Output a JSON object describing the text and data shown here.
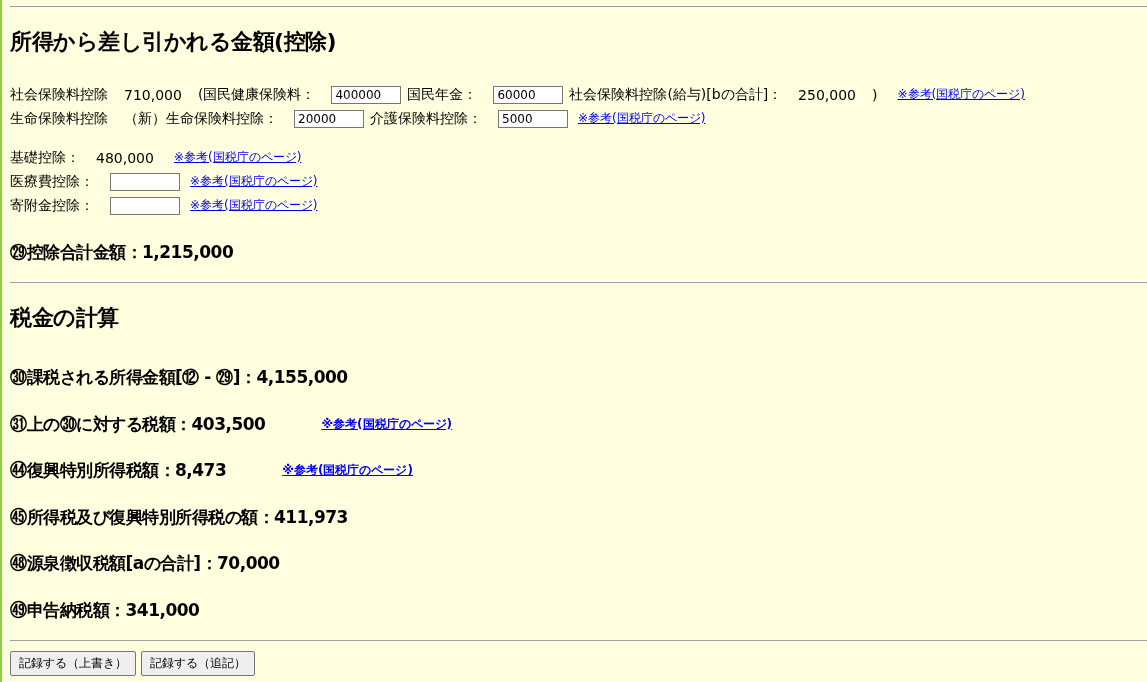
{
  "sections": [
    {
      "heading": "所得から差し引かれる金額(控除)",
      "groups": [
        {
          "kind": "rows",
          "lines": [
            {
              "parts": [
                {
                  "kind": "text",
                  "text": "社会保険料控除"
                },
                {
                  "kind": "text",
                  "text": "710,000"
                },
                {
                  "kind": "text",
                  "text": "(国民健康保険料："
                },
                {
                  "kind": "field",
                  "value": "400000"
                },
                {
                  "kind": "text",
                  "text": "国民年金："
                },
                {
                  "kind": "field",
                  "value": "60000"
                },
                {
                  "kind": "text",
                  "text": "社会保険料控除(給与)[bの合計]："
                },
                {
                  "kind": "text",
                  "text": "250,000"
                },
                {
                  "kind": "text",
                  "text": ")"
                },
                {
                  "kind": "link",
                  "text": "※参考(国税庁のページ)"
                }
              ]
            },
            {
              "parts": [
                {
                  "kind": "text",
                  "text": "生命保険料控除"
                },
                {
                  "kind": "text",
                  "text": "（新）生命保険料控除："
                },
                {
                  "kind": "field",
                  "value": "20000"
                },
                {
                  "kind": "text",
                  "text": "介護保険料控除："
                },
                {
                  "kind": "field",
                  "value": "5000"
                },
                {
                  "kind": "link",
                  "text": "※参考(国税庁のページ)"
                }
              ]
            }
          ]
        },
        {
          "kind": "rows",
          "lines": [
            {
              "parts": [
                {
                  "kind": "text",
                  "text": "基礎控除："
                },
                {
                  "kind": "text",
                  "text": "480,000"
                },
                {
                  "kind": "link",
                  "text": "※参考(国税庁のページ)"
                }
              ]
            },
            {
              "parts": [
                {
                  "kind": "text",
                  "text": "医療費控除："
                },
                {
                  "kind": "field"
                },
                {
                  "kind": "link",
                  "text": "※参考(国税庁のページ)"
                }
              ]
            },
            {
              "parts": [
                {
                  "kind": "text",
                  "text": "寄附金控除："
                },
                {
                  "kind": "field"
                },
                {
                  "kind": "link",
                  "text": "※参考(国税庁のページ)"
                }
              ]
            }
          ]
        },
        {
          "kind": "totals",
          "lines": [
            {
              "parts": [
                {
                  "kind": "text",
                  "text": "㉙控除合計金額：1,215,000"
                }
              ]
            }
          ]
        }
      ]
    },
    {
      "heading": "税金の計算",
      "groups": [
        {
          "kind": "totals",
          "lines": [
            {
              "parts": [
                {
                  "kind": "text",
                  "text": "㉚課税される所得金額[⑫ - ㉙]：4,155,000"
                }
              ]
            },
            {
              "parts": [
                {
                  "kind": "text",
                  "text": "㉛上の㉚に対する税額：403,500"
                },
                {
                  "kind": "link",
                  "text": "※参考(国税庁のページ)"
                }
              ]
            },
            {
              "parts": [
                {
                  "kind": "text",
                  "text": "㊹復興特別所得税額：8,473"
                },
                {
                  "kind": "link",
                  "text": "※参考(国税庁のページ)"
                }
              ]
            },
            {
              "parts": [
                {
                  "kind": "text",
                  "text": "㊺所得税及び復興特別所得税の額：411,973"
                }
              ]
            },
            {
              "parts": [
                {
                  "kind": "text",
                  "text": "㊽源泉徴収税額[aの合計]：70,000"
                }
              ]
            },
            {
              "parts": [
                {
                  "kind": "text",
                  "text": "㊾申告納税額：341,000"
                }
              ]
            }
          ]
        }
      ]
    }
  ],
  "buttons": [
    "記録する（上書き）",
    "記録する（追記）"
  ]
}
